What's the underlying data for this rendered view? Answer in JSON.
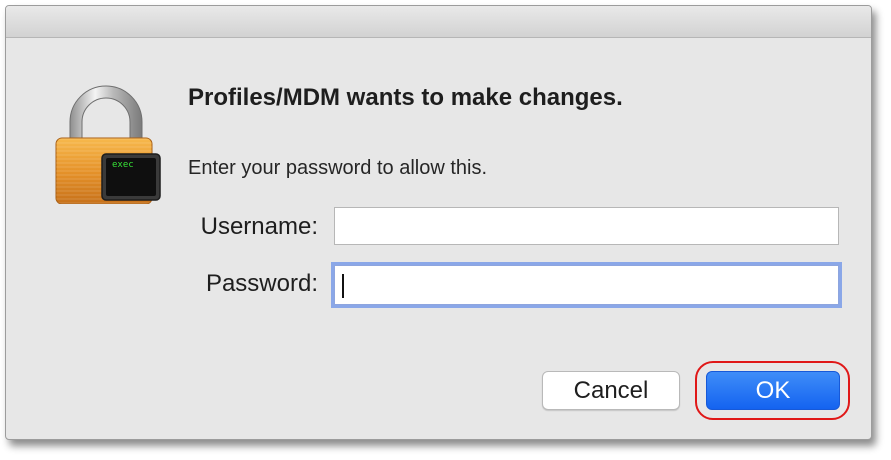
{
  "dialog": {
    "heading": "Profiles/MDM wants to make changes.",
    "subtext": "Enter your password to allow this.",
    "lock_terminal_text": "exec"
  },
  "form": {
    "username_label": "Username:",
    "username_value": "",
    "password_label": "Password:",
    "password_value": ""
  },
  "buttons": {
    "cancel_label": "Cancel",
    "ok_label": "OK"
  },
  "colors": {
    "accent": "#1463f0",
    "focus_ring": "#8aa7e8",
    "highlight": "#e01818"
  },
  "icons": {
    "app_icon": "padlock-with-terminal-icon"
  }
}
